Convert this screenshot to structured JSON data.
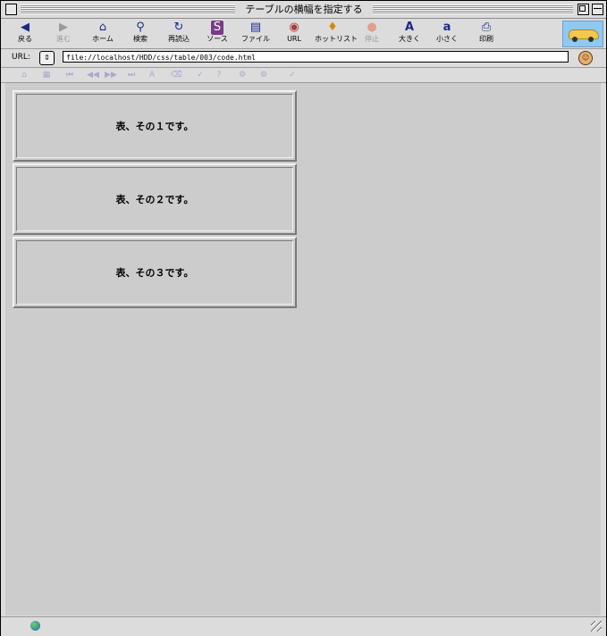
{
  "window": {
    "title": "テーブルの横幅を指定する"
  },
  "toolbar": {
    "buttons": [
      {
        "label": "戻る",
        "icon": "◀",
        "icon_name": "back-icon",
        "enabled": true
      },
      {
        "label": "進む",
        "icon": "▶",
        "icon_name": "forward-icon",
        "enabled": false
      },
      {
        "label": "ホーム",
        "icon": "⌂",
        "icon_name": "home-icon",
        "enabled": true
      },
      {
        "label": "検索",
        "icon": "⚲",
        "icon_name": "search-icon",
        "enabled": true
      },
      {
        "label": "再読込",
        "icon": "↻",
        "icon_name": "reload-icon",
        "enabled": true
      },
      {
        "label": "ソース",
        "icon": "S",
        "icon_name": "source-icon",
        "enabled": true
      },
      {
        "label": "ファイル",
        "icon": "▤",
        "icon_name": "file-icon",
        "enabled": true
      },
      {
        "label": "URL",
        "icon": "◉",
        "icon_name": "url-icon",
        "enabled": true
      },
      {
        "label": "ホットリスト",
        "icon": "♦",
        "icon_name": "hotlist-icon",
        "enabled": true
      },
      {
        "label": "停止",
        "icon": "●",
        "icon_name": "stop-icon",
        "enabled": false
      },
      {
        "label": "大きく",
        "icon": "A",
        "icon_name": "bigger-text-icon",
        "enabled": true
      },
      {
        "label": "小さく",
        "icon": "a",
        "icon_name": "smaller-text-icon",
        "enabled": true
      },
      {
        "label": "印刷",
        "icon": "⎙",
        "icon_name": "print-icon",
        "enabled": true
      }
    ]
  },
  "urlbar": {
    "label": "URL:",
    "stepper_icon": "⇕",
    "value": "file://localhost/HDD/css/table/003/code.html"
  },
  "navbar": {
    "icons": [
      "⌂",
      "▦",
      "⏮",
      "◀◀",
      "▶▶",
      "⏭",
      "A",
      "⌫",
      "✓",
      "?",
      "⚙",
      "⚙",
      "✓"
    ]
  },
  "tables": [
    {
      "text": "表、その１です。"
    },
    {
      "text": "表、その２です。"
    },
    {
      "text": "表、その３です。"
    }
  ],
  "colors": {
    "content_bg": "#cccccc",
    "chrome_bg": "#dcdcdc",
    "icon_blue": "#1a2a8a"
  }
}
